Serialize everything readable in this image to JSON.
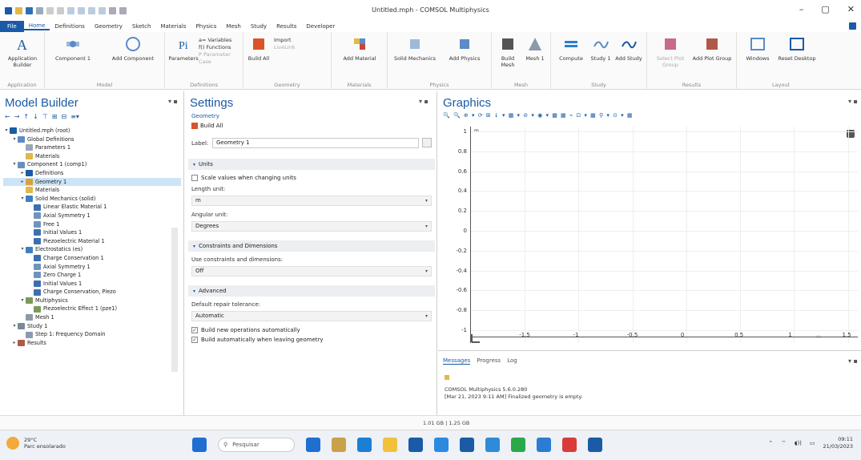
{
  "window": {
    "title": "Untitled.mph - COMSOL Multiphysics",
    "minimize": "–",
    "maximize": "▢",
    "close": "✕"
  },
  "ribbon_tabs": [
    "File",
    "Home",
    "Definitions",
    "Geometry",
    "Sketch",
    "Materials",
    "Physics",
    "Mesh",
    "Study",
    "Results",
    "Developer"
  ],
  "ribbon": {
    "application_builder": "Application Builder",
    "component": "Component 1",
    "add_component": "Add Component",
    "parameters": "Parameters",
    "variables": "a= Variables",
    "functions": "f() Functions",
    "parameter_case": "P Parameter Case",
    "build_all": "Build All",
    "import": "Import",
    "livelink": "LiveLink",
    "add_material": "Add Material",
    "solid_mechanics": "Solid Mechanics",
    "add_physics": "Add Physics",
    "build_mesh": "Build Mesh",
    "mesh_1": "Mesh 1",
    "compute": "Compute",
    "study_1": "Study 1",
    "add_study": "Add Study",
    "select_plot_group": "Select Plot Group",
    "add_plot_group": "Add Plot Group",
    "windows": "Windows",
    "reset_desktop": "Reset Desktop",
    "groups": {
      "application": "Application",
      "model": "Model",
      "definitions": "Definitions",
      "geometry": "Geometry",
      "materials": "Materials",
      "physics": "Physics",
      "mesh": "Mesh",
      "study": "Study",
      "results": "Results",
      "layout": "Layout"
    }
  },
  "model_builder": {
    "title": "Model Builder",
    "tree": [
      {
        "label": "Untitled.mph (root)",
        "level": 0,
        "color": "#1b5aa6",
        "arrow": "▾"
      },
      {
        "label": "Global Definitions",
        "level": 1,
        "color": "#5b8bc8",
        "arrow": "▾"
      },
      {
        "label": "Parameters 1",
        "level": 2,
        "color": "#9aa7b5",
        "arrow": ""
      },
      {
        "label": "Materials",
        "level": 2,
        "color": "#e2b84a",
        "arrow": ""
      },
      {
        "label": "Component 1 (comp1)",
        "level": 1,
        "color": "#6a8fbf",
        "arrow": "▾"
      },
      {
        "label": "Definitions",
        "level": 2,
        "color": "#1b5aa6",
        "arrow": "▸"
      },
      {
        "label": "Geometry 1",
        "level": 2,
        "color": "#d9a03a",
        "arrow": "▸",
        "selected": true
      },
      {
        "label": "Materials",
        "level": 2,
        "color": "#e2b84a",
        "arrow": ""
      },
      {
        "label": "Solid Mechanics (solid)",
        "level": 2,
        "color": "#3d7fc4",
        "arrow": "▾"
      },
      {
        "label": "Linear Elastic Material 1",
        "level": 3,
        "color": "#3d6fb0",
        "arrow": ""
      },
      {
        "label": "Axial Symmetry 1",
        "level": 3,
        "color": "#6f93bf",
        "arrow": ""
      },
      {
        "label": "Free 1",
        "level": 3,
        "color": "#6f93bf",
        "arrow": ""
      },
      {
        "label": "Initial Values 1",
        "level": 3,
        "color": "#3d6fb0",
        "arrow": ""
      },
      {
        "label": "Piezoelectric Material 1",
        "level": 3,
        "color": "#3d6fb0",
        "arrow": ""
      },
      {
        "label": "Electrostatics (es)",
        "level": 2,
        "color": "#3d7fc4",
        "arrow": "▾"
      },
      {
        "label": "Charge Conservation 1",
        "level": 3,
        "color": "#3d6fb0",
        "arrow": ""
      },
      {
        "label": "Axial Symmetry 1",
        "level": 3,
        "color": "#6f93bf",
        "arrow": ""
      },
      {
        "label": "Zero Charge 1",
        "level": 3,
        "color": "#6f93bf",
        "arrow": ""
      },
      {
        "label": "Initial Values 1",
        "level": 3,
        "color": "#3d6fb0",
        "arrow": ""
      },
      {
        "label": "Charge Conservation, Piezo",
        "level": 3,
        "color": "#3d6fb0",
        "arrow": ""
      },
      {
        "label": "Multiphysics",
        "level": 2,
        "color": "#7a9a5a",
        "arrow": "▾"
      },
      {
        "label": "Piezoelectric Effect 1 (pze1)",
        "level": 3,
        "color": "#7a9a5a",
        "arrow": ""
      },
      {
        "label": "Mesh 1",
        "level": 2,
        "color": "#8a9aa8",
        "arrow": ""
      },
      {
        "label": "Study 1",
        "level": 1,
        "color": "#7a8a9a",
        "arrow": "▾"
      },
      {
        "label": "Step 1: Frequency Domain",
        "level": 2,
        "color": "#8a9ab0",
        "arrow": ""
      },
      {
        "label": "Results",
        "level": 1,
        "color": "#b0594a",
        "arrow": "▸"
      }
    ]
  },
  "settings": {
    "title": "Settings",
    "subtitle": "Geometry",
    "build_all": "Build All",
    "label_caption": "Label:",
    "label_value": "Geometry 1",
    "units_section": "Units",
    "scale_values": "Scale values when changing units",
    "length_unit_caption": "Length unit:",
    "length_unit": "m",
    "angular_unit_caption": "Angular unit:",
    "angular_unit": "Degrees",
    "constraints_section": "Constraints and Dimensions",
    "use_constraints_caption": "Use constraints and dimensions:",
    "use_constraints": "Off",
    "advanced_section": "Advanced",
    "repair_caption": "Default repair tolerance:",
    "repair": "Automatic",
    "build_new_ops": "Build new operations automatically",
    "build_on_leave": "Build automatically when leaving geometry"
  },
  "graphics": {
    "title": "Graphics",
    "toolbar": "🔍 🔍 ⊕ ▾ ⟳ ⊞ ↓ ▾ ▦ ▾ ⊘ ▾ ◉ ▾ ▦ ▦ ⌁ ⊡ ▾ ▦ ⚲ ▾ ⊙ ▾ ▦"
  },
  "chart_data": {
    "type": "scatter",
    "x_ticks": [
      "-1.5",
      "-1",
      "-0.5",
      "0",
      "0.5",
      "1",
      "1.5"
    ],
    "y_ticks": [
      "1",
      "0.8",
      "0.6",
      "0.4",
      "0.2",
      "0",
      "-0.2",
      "-0.4",
      "-0.6",
      "-0.8",
      "-1"
    ],
    "xlim": [
      -2,
      1.6
    ],
    "ylim": [
      -1,
      1
    ],
    "grid": true,
    "axis_corner_label": "y",
    "axis_corner_label_x": "z",
    "unit_badge": "m",
    "unit_badge_x": "m"
  },
  "messages": {
    "tabs": [
      "Messages",
      "Progress",
      "Log"
    ],
    "lines": [
      "COMSOL Multiphysics 5.6.0.280",
      "[Mar 21, 2023 9:11 AM] Finalized geometry is empty."
    ]
  },
  "status": {
    "memory": "1.01 GB | 1.25 GB"
  },
  "taskbar": {
    "temperature": "29°C",
    "weather": "Parc ensolarado",
    "search": "Pesquisar",
    "time": "09:11",
    "date": "21/03/2023",
    "app_colors": [
      "#1f6fd1",
      "#c9a14a",
      "#1b7fd6",
      "#f0c23a",
      "#1b5aa6",
      "#2b8ae0",
      "#1b5aa6",
      "#2f8bd8",
      "#2aa84a",
      "#2b7cd3",
      "#d93b3b",
      "#1b5aa6"
    ]
  },
  "colors": {
    "accent": "#1b5aa6",
    "selection": "#cde4f7"
  }
}
